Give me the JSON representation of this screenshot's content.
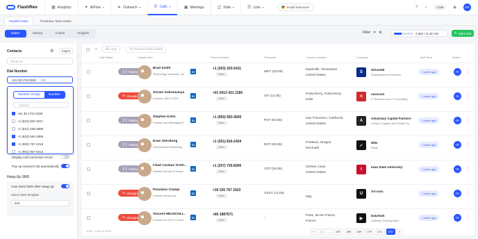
{
  "app": {
    "name": "FlashRev"
  },
  "nav": [
    {
      "label": "Analytics",
      "icon": "chart-icon"
    },
    {
      "label": "AIFlow",
      "icon": "flow-icon"
    },
    {
      "label": "Outreach",
      "icon": "send-icon"
    },
    {
      "label": "Calls",
      "icon": "phone-icon"
    },
    {
      "label": "Meetings",
      "icon": "calendar-icon"
    },
    {
      "label": "Data",
      "icon": "database-icon"
    },
    {
      "label": "Lists",
      "icon": "list-icon"
    }
  ],
  "extension_label": "Install Extension",
  "credits": "2.5M",
  "user_initials": "FR",
  "top_tabs": [
    {
      "label": "Parallel Dialer"
    },
    {
      "label": "Predictive Team Dialer"
    }
  ],
  "dialer_tabs": [
    {
      "label": "Dialer"
    },
    {
      "label": "History"
    },
    {
      "label": "Coach"
    },
    {
      "label": "Insights"
    }
  ],
  "filter_label": "Filter",
  "progress": {
    "text": "4,658 / 11.3K min",
    "fraction": 0.41
  },
  "start_label": "Start Dial",
  "sidebar": {
    "contacts_label": "Contacts",
    "import_label": "Import",
    "contacts_placeholder": "Shortcuts",
    "dial_number_label": "Dial Number",
    "dial_number_value": "+61 30 1721 8182",
    "dial_number_extra": "+ 2",
    "popup": {
      "toggle": [
        "Number Group",
        "Number"
      ],
      "search_placeholder": "Search",
      "numbers": [
        {
          "label": "+61 30 1721 8182",
          "checked": true
        },
        {
          "label": "+1 (610) 904-3317",
          "checked": false
        },
        {
          "label": "+1 (612) 496-3889",
          "checked": false
        },
        {
          "label": "+1 (833) 554-2889",
          "checked": true
        },
        {
          "label": "+1 (850) 757-2219",
          "checked": true
        },
        {
          "label": "+1 (951) 967-9213",
          "checked": false
        }
      ]
    },
    "options": [
      {
        "label": "Auto skip contacts",
        "on": false
      },
      {
        "label": "Display call connection errors",
        "on": false
      },
      {
        "label": "Pop up research tab automatically",
        "on": true
      }
    ],
    "hangup_label": "Hang-Up SMS",
    "auto_sms_label": "Auto Send SMS After Hang Up",
    "sms_template_label": "Select SMS template",
    "sms_template_value": "test"
  },
  "actions": {
    "copy": "Copy",
    "remove": "Remove from Dialer"
  },
  "headers": [
    "Call Status",
    "Contact Info",
    "Phone Number",
    "Timezone",
    "Contact Location",
    "Company",
    "Add Time",
    "Owner"
  ],
  "rows": [
    {
      "status": "Waiting",
      "name": "Brad Smith",
      "title": "Technology executive, an",
      "phone": "+1 (303) 320-5411",
      "tag": "Other",
      "tz": "MDT (03:05)",
      "loc1": "Nashville, Tennessee",
      "loc2": "United States",
      "company": "SiriusXM",
      "industry": "Entertainment Providers",
      "ago": "1 week ago",
      "logo_color": "#0a2a8a",
      "logo_text": "S"
    },
    {
      "status": "Unsupported",
      "name": "Sriram Subramanya",
      "title": "Founder, MD & CEO",
      "phone": "+91 5413 421 2180",
      "tag": "Other",
      "tz": "IST (14:35)",
      "loc1": "Puducherry, Puducherry",
      "loc2": "India",
      "company": "nasscom",
      "industry": "IT Services and IT Consulting",
      "ago": "1 week ago",
      "logo_color": "#d12b2b",
      "logo_text": "n"
    },
    {
      "status": "Waiting",
      "name": "Stephen Kuhn",
      "title": "Founder and Managing P",
      "phone": "+1 (650) 583-3600",
      "tag": "Other",
      "tz": "PDT (02:05)",
      "loc1": "San Francisco, California",
      "loc2": "United States",
      "company": "Advantary Capital Partners",
      "industry": "Venture Capital and Private Eq",
      "ago": "1 week ago",
      "logo_color": "#222222",
      "logo_text": "A"
    },
    {
      "status": "Waiting",
      "name": "Evan Sternberg",
      "title": "Global Brand Marketing",
      "phone": "+1 (301) 816-2424",
      "tag": "Other",
      "tz": "EDT (05:05)",
      "loc1": "Portland, Oregon",
      "loc2": "Denmark",
      "company": "Nike",
      "industry": "Retail",
      "ago": "1 week ago",
      "logo_color": "#111111",
      "logo_text": "✓"
    },
    {
      "status": "Waiting",
      "name": "Chad Cardani Troth...",
      "title": "Athletic Director & Assoc",
      "phone": "+1 (337) 735-8300",
      "tag": "Other",
      "tz": "CDT (04:05)",
      "loc1": "Grimes, Iowa",
      "loc2": "United States",
      "company": "Iowa State University",
      "industry": "",
      "ago": "1 week ago",
      "logo_color": "#c8102e",
      "logo_text": "I"
    },
    {
      "status": "Unsupported",
      "name": "Ponziano Ciampi",
      "title": "Founder at Artcorp",
      "phone": "+39 335 757 1623",
      "tag": "Other",
      "tz": "CEST (11:05)",
      "loc1": "-",
      "loc2": "Italy",
      "company": "Art-urns",
      "industry": "",
      "ago": "1 week ago",
      "logo_color": "#111111",
      "logo_text": "U"
    },
    {
      "status": "Unsupported",
      "name": "Vincent HEUSCHLI...",
      "title": "Founder of CEO & Creat",
      "phone": "+86 1887671",
      "tag": "Other",
      "tz": "-",
      "loc1": "Paris, Ile-de-France",
      "loc2": "France",
      "company": "DataTask",
      "industry": "Software Development",
      "ago": "1 week ago",
      "logo_color": "#111111",
      "logo_text": "▶"
    }
  ],
  "footer_note": "1000 - 1570 of 1570",
  "pages": [
    "<",
    "1",
    "...",
    "267",
    "268",
    "269",
    "270",
    "271",
    "272",
    ">"
  ],
  "active_page": "272"
}
